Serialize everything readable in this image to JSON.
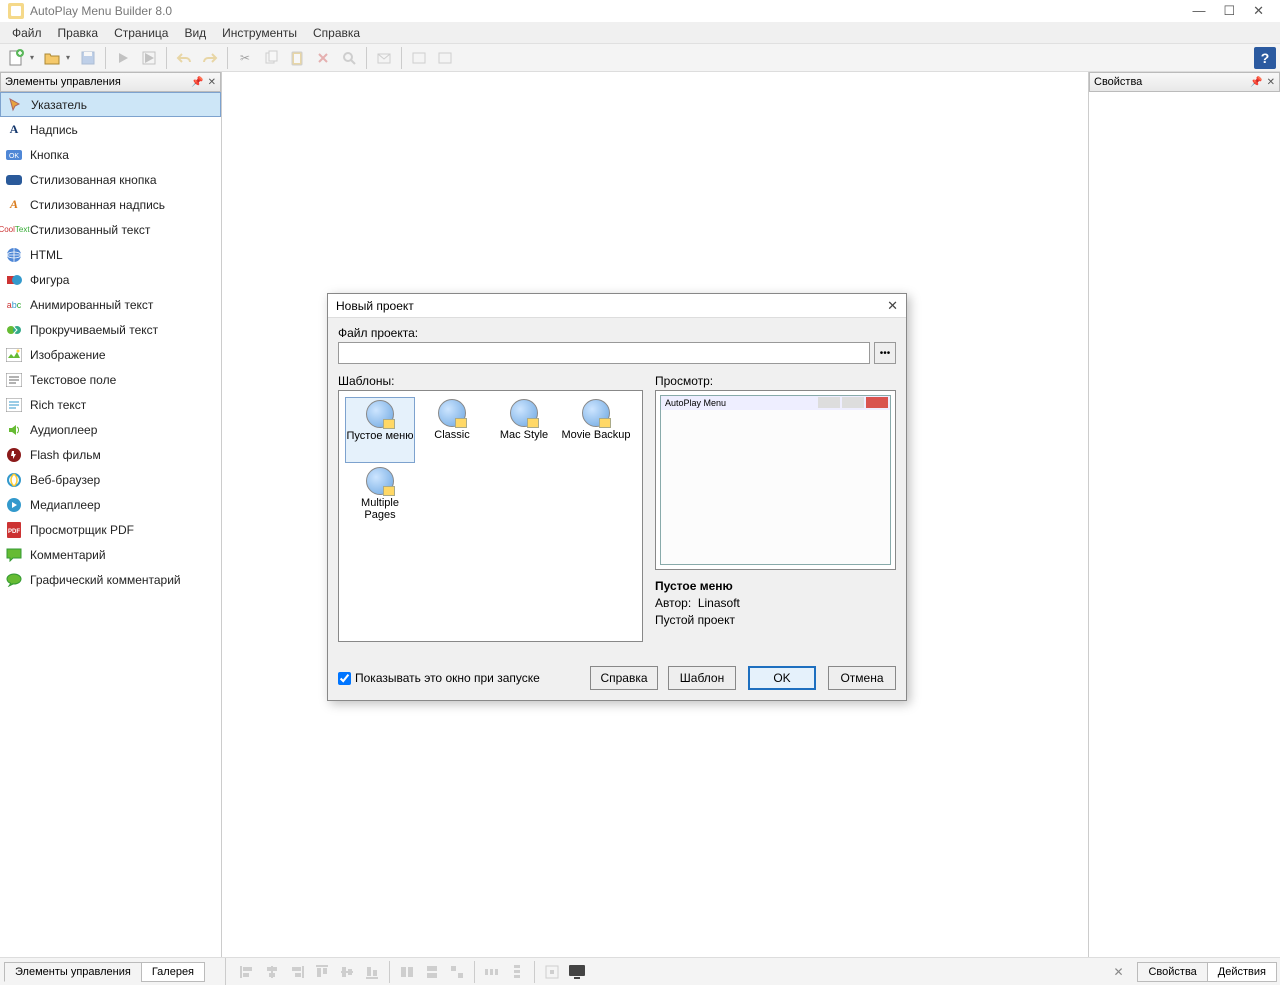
{
  "app": {
    "title": "AutoPlay Menu Builder 8.0"
  },
  "menu": {
    "items": [
      "Файл",
      "Правка",
      "Страница",
      "Вид",
      "Инструменты",
      "Справка"
    ]
  },
  "panel_left": {
    "title": "Элементы управления"
  },
  "panel_right": {
    "title": "Свойства"
  },
  "tools": [
    {
      "label": "Указатель"
    },
    {
      "label": "Надпись"
    },
    {
      "label": "Кнопка"
    },
    {
      "label": "Стилизованная кнопка"
    },
    {
      "label": "Стилизованная надпись"
    },
    {
      "label": "Стилизованный текст"
    },
    {
      "label": "HTML"
    },
    {
      "label": "Фигура"
    },
    {
      "label": "Анимированный текст"
    },
    {
      "label": "Прокручиваемый текст"
    },
    {
      "label": "Изображение"
    },
    {
      "label": "Текстовое поле"
    },
    {
      "label": "Rich текст"
    },
    {
      "label": "Аудиоплеер"
    },
    {
      "label": "Flash фильм"
    },
    {
      "label": "Веб-браузер"
    },
    {
      "label": "Медиаплеер"
    },
    {
      "label": "Просмотрщик PDF"
    },
    {
      "label": "Комментарий"
    },
    {
      "label": "Графический комментарий"
    }
  ],
  "dialog": {
    "title": "Новый проект",
    "file_label": "Файл проекта:",
    "file_value": "",
    "templates_label": "Шаблоны:",
    "preview_label": "Просмотр:",
    "templates": [
      {
        "label": "Пустое меню",
        "selected": true
      },
      {
        "label": "Classic"
      },
      {
        "label": "Mac Style"
      },
      {
        "label": "Movie Backup"
      },
      {
        "label": "Multiple Pages"
      }
    ],
    "preview_window_title": "AutoPlay Menu",
    "preview_name": "Пустое меню",
    "preview_author_label": "Автор:",
    "preview_author": "Linasoft",
    "preview_desc": "Пустой проект",
    "show_on_start": "Показывать это окно при запуске",
    "btn_help": "Справка",
    "btn_template": "Шаблон",
    "btn_ok": "OK",
    "btn_cancel": "Отмена"
  },
  "bottom": {
    "tab_controls": "Элементы управления",
    "tab_gallery": "Галерея",
    "tab_props": "Свойства",
    "tab_actions": "Действия"
  }
}
